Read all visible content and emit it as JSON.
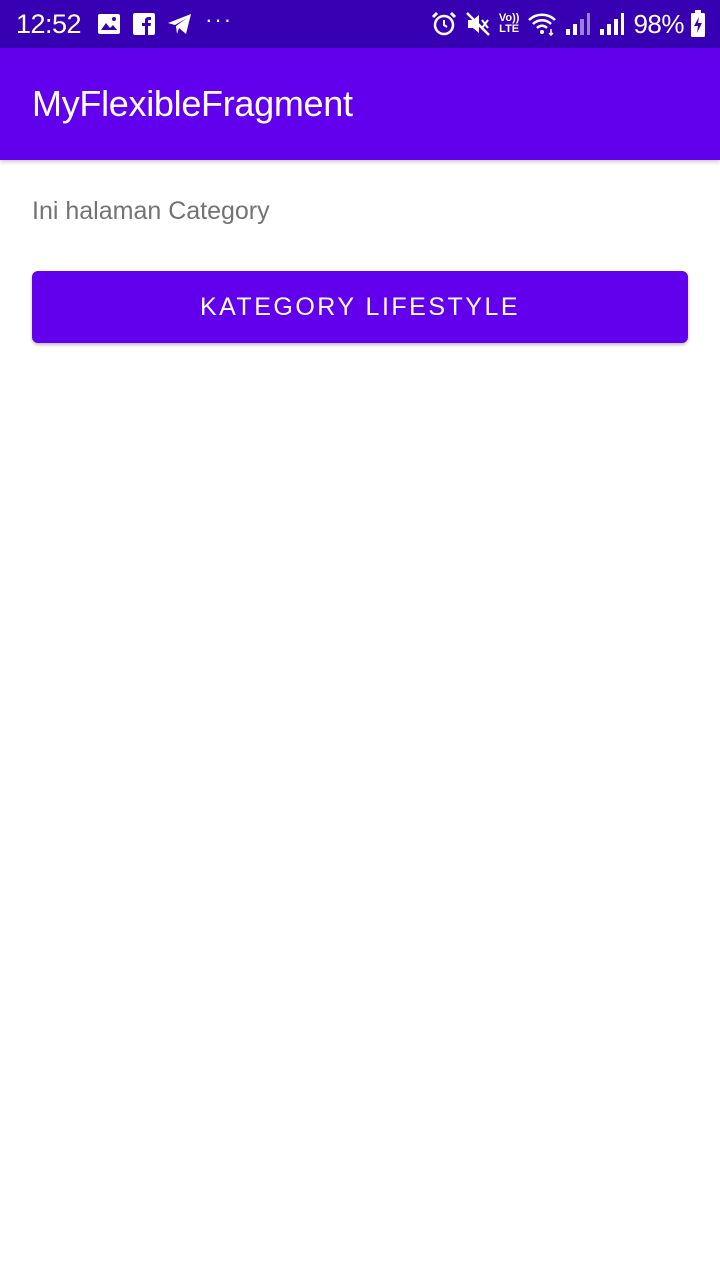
{
  "status_bar": {
    "time": "12:52",
    "left_icons": [
      "image-icon",
      "facebook-icon",
      "telegram-icon",
      "more-dots-icon"
    ],
    "more_dots": "···",
    "right_icons": [
      "alarm-icon",
      "mute-icon",
      "volte-icon",
      "wifi-icon",
      "signal-icon",
      "signal-icon",
      "battery-charging-icon"
    ],
    "volte_top": "Vo))",
    "volte_bottom": "LTE",
    "battery_percent": "98%",
    "color": "#3700b3"
  },
  "app_bar": {
    "title": "MyFlexibleFragment",
    "color": "#6200ee"
  },
  "content": {
    "page_text": "Ini halaman Category",
    "category_button_label": "KATEGORY LIFESTYLE",
    "button_color": "#6200ee"
  }
}
